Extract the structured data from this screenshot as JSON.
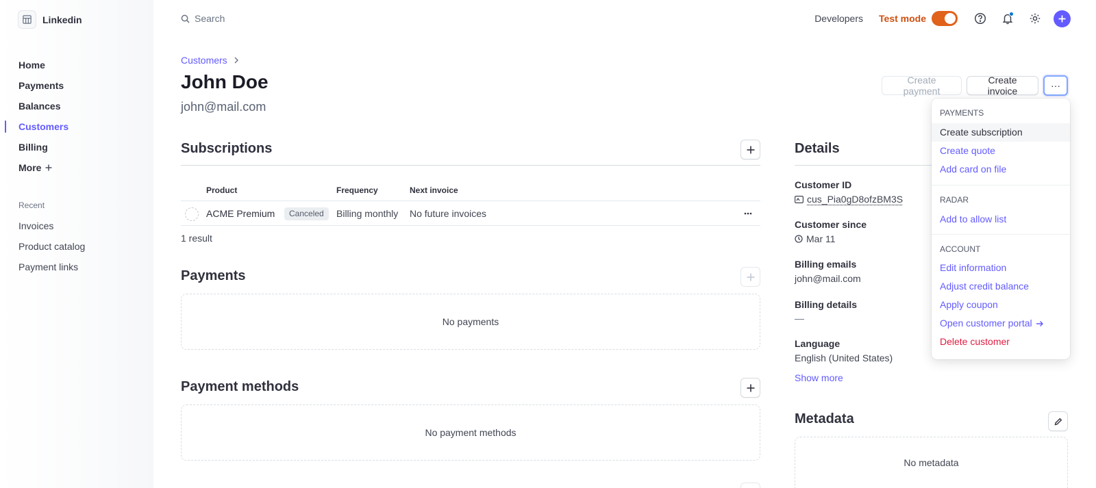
{
  "brand": {
    "name": "Linkedin"
  },
  "nav": {
    "items": [
      {
        "label": "Home"
      },
      {
        "label": "Payments"
      },
      {
        "label": "Balances"
      },
      {
        "label": "Customers"
      },
      {
        "label": "Billing"
      },
      {
        "label": "More"
      }
    ],
    "recent_title": "Recent",
    "recent": [
      {
        "label": "Invoices"
      },
      {
        "label": "Product catalog"
      },
      {
        "label": "Payment links"
      }
    ]
  },
  "topbar": {
    "search_placeholder": "Search",
    "developers": "Developers",
    "test_mode": "Test mode",
    "test_mode_on": true
  },
  "breadcrumb": {
    "parent": "Customers"
  },
  "customer": {
    "name": "John Doe",
    "email": "john@mail.com"
  },
  "actions": {
    "create_payment": "Create payment",
    "create_invoice": "Create invoice",
    "more": "···"
  },
  "subscriptions": {
    "title": "Subscriptions",
    "columns": [
      "Product",
      "Frequency",
      "Next invoice"
    ],
    "row": {
      "product": "ACME Premium",
      "status": "Canceled",
      "frequency": "Billing monthly",
      "next_invoice": "No future invoices"
    },
    "count": "1 result"
  },
  "payments": {
    "title": "Payments",
    "empty": "No payments"
  },
  "payment_methods": {
    "title": "Payment methods",
    "empty": "No payment methods"
  },
  "details": {
    "title": "Details",
    "customer_id_label": "Customer ID",
    "customer_id": "cus_Pia0gD8ofzBM3S",
    "since_label": "Customer since",
    "since": "Mar 11",
    "billing_emails_label": "Billing emails",
    "billing_emails": "john@mail.com",
    "billing_details_label": "Billing details",
    "billing_details": "—",
    "language_label": "Language",
    "language": "English (United States)",
    "show_more": "Show more"
  },
  "metadata": {
    "title": "Metadata",
    "empty": "No metadata"
  },
  "menu": {
    "payments_head": "PAYMENTS",
    "create_subscription": "Create subscription",
    "create_quote": "Create quote",
    "add_card": "Add card on file",
    "radar_head": "RADAR",
    "allow_list": "Add to allow list",
    "account_head": "ACCOUNT",
    "edit_info": "Edit information",
    "adjust_credit": "Adjust credit balance",
    "apply_coupon": "Apply coupon",
    "open_portal": "Open customer portal",
    "delete": "Delete customer"
  },
  "colors": {
    "accent": "#635bff",
    "test_mode": "#e0621b",
    "danger": "#df1b41"
  }
}
